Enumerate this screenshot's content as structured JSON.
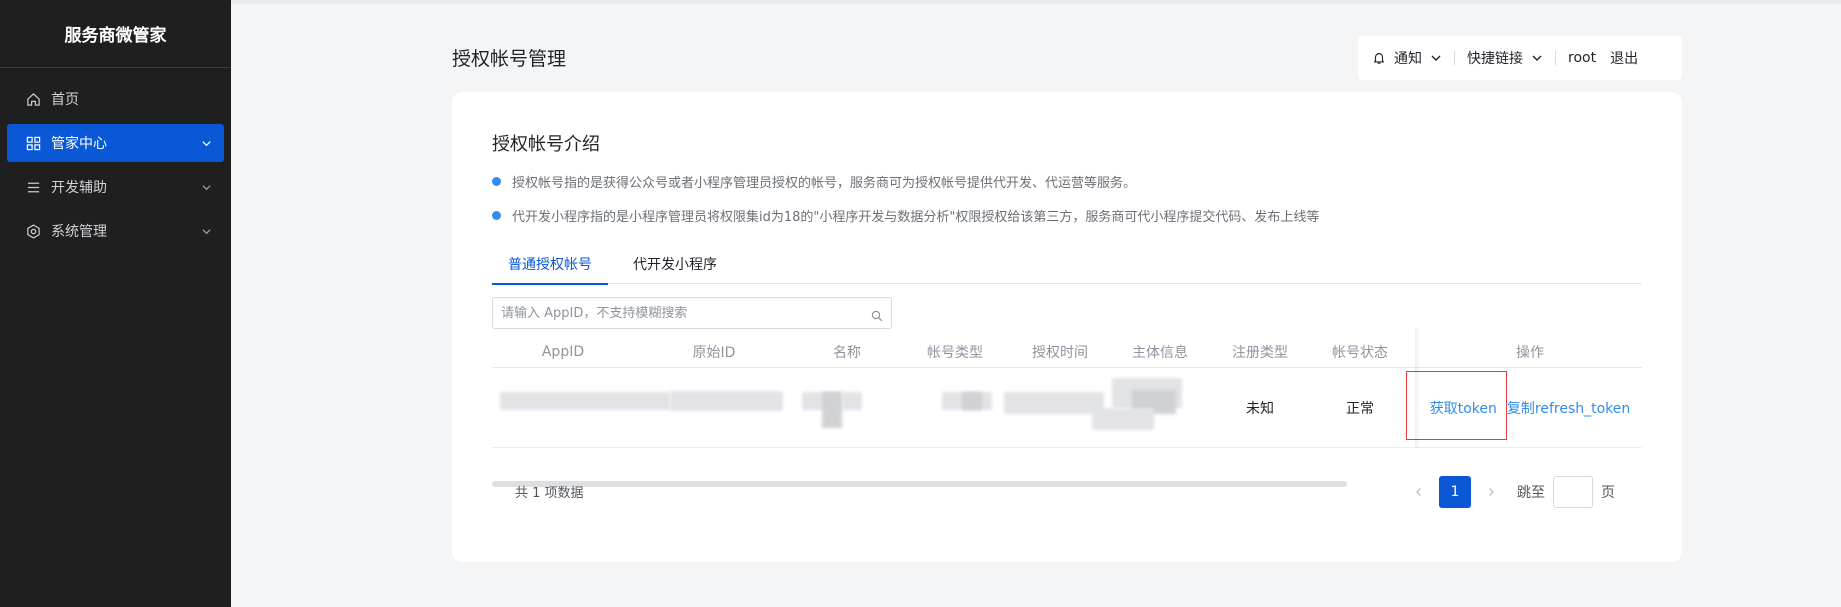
{
  "app": {
    "title": "服务商微管家"
  },
  "sidebar": {
    "items": [
      {
        "label": "首页",
        "icon": "home-icon",
        "active": false,
        "has_chevron": false
      },
      {
        "label": "管家中心",
        "icon": "grid-icon",
        "active": true,
        "has_chevron": true
      },
      {
        "label": "开发辅助",
        "icon": "list-icon",
        "active": false,
        "has_chevron": true
      },
      {
        "label": "系统管理",
        "icon": "settings-hex-icon",
        "active": false,
        "has_chevron": true
      }
    ]
  },
  "header": {
    "title": "授权帐号管理",
    "notify_label": "通知",
    "shortcut_label": "快捷链接",
    "user": "root",
    "logout_label": "退出"
  },
  "intro": {
    "title": "授权帐号介绍",
    "bullets": [
      "授权帐号指的是获得公众号或者小程序管理员授权的帐号，服务商可为授权帐号提供代开发、代运营等服务。",
      "代开发小程序指的是小程序管理员将权限集id为18的\"小程序开发与数据分析\"权限授权给该第三方，服务商可代小程序提交代码、发布上线等"
    ]
  },
  "tabs": [
    {
      "label": "普通授权帐号",
      "active": true
    },
    {
      "label": "代开发小程序",
      "active": false
    }
  ],
  "search": {
    "placeholder": "请输入 AppID，不支持模糊搜索",
    "value": ""
  },
  "table": {
    "columns": [
      "AppID",
      "原始ID",
      "名称",
      "帐号类型",
      "授权时间",
      "主体信息",
      "注册类型",
      "帐号状态",
      "操作"
    ],
    "rows": [
      {
        "register_type": "未知",
        "account_status": "正常",
        "actions": [
          "获取token",
          "复制refresh_token"
        ]
      }
    ]
  },
  "footer": {
    "total_text": "共 1 项数据",
    "current_page": "1",
    "jump_label": "跳至",
    "page_suffix": "页"
  },
  "colors": {
    "sidebar_bg": "#1f1f1f",
    "accent": "#0a58d6",
    "link": "#2f8cf0",
    "highlight_box": "#e23c3c"
  }
}
